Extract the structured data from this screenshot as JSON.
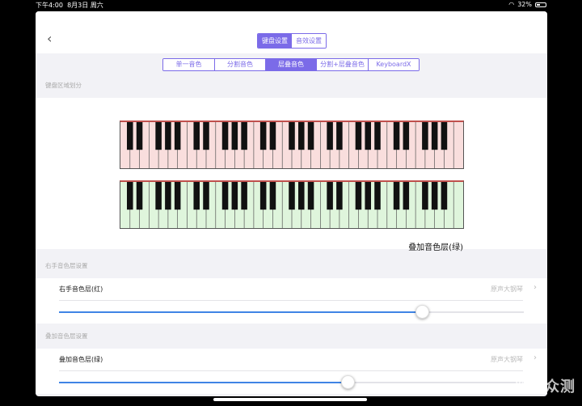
{
  "status": {
    "time": "下午4:00",
    "date": "8月3日 周六",
    "battery": "32%"
  },
  "nav": {
    "back_icon": "chevron-left-icon",
    "segments": [
      {
        "label": "键盘设置",
        "active": true
      },
      {
        "label": "音效设置",
        "active": false
      }
    ]
  },
  "tabs": [
    {
      "label": "单一音色",
      "active": false
    },
    {
      "label": "分割音色",
      "active": false
    },
    {
      "label": "层叠音色",
      "active": true
    },
    {
      "label": "分割+层叠音色",
      "active": false
    },
    {
      "label": "KeyboardX",
      "active": false
    }
  ],
  "sections": {
    "keyboard_zone": "键盘区域划分",
    "right_layer": "右手音色层设置",
    "overlay_layer": "叠加音色层设置"
  },
  "keyboard": {
    "caption": "叠加音色层(绿)",
    "white_keys": 36
  },
  "rows": {
    "right": {
      "title": "右手音色层(红)",
      "value": "原声大钢琴",
      "slider": 0.78
    },
    "overlay": {
      "title": "叠加音色层(绿)",
      "value": "原声大钢琴",
      "slider": 0.62
    }
  },
  "watermark": "新浪众测",
  "colors": {
    "accent": "#7b6be8",
    "slider": "#3f84e5",
    "red_layer": "#f9dedd",
    "green_layer": "#dff5dc"
  }
}
